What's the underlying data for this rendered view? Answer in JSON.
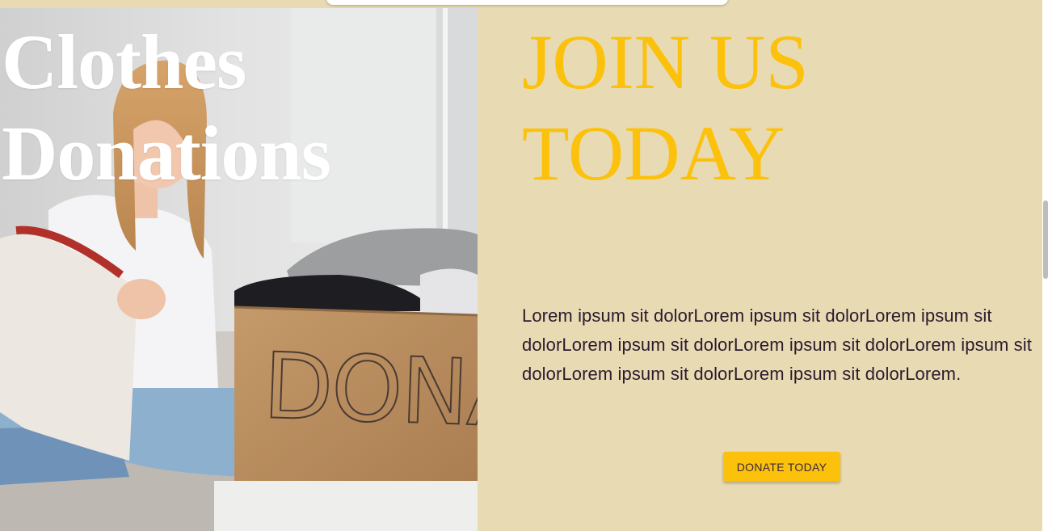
{
  "hero": {
    "title_line1": "Clothes",
    "title_line2": "Donations",
    "image": "woman-packing-clothes-donation-box-photo",
    "box_text": "DONATE"
  },
  "join": {
    "title_line1": "JOIN US",
    "title_line2": "TODAY",
    "body": "Lorem ipsum sit dolorLorem ipsum sit dolorLorem ipsum sit dolorLorem ipsum sit dolorLorem ipsum sit dolorLorem ipsum sit dolorLorem ipsum sit dolorLorem ipsum sit dolorLorem.",
    "button_label": "DONATE TODAY"
  },
  "colors": {
    "background": "#e8dab3",
    "accent": "#fcc10a",
    "body_text": "#2a1b2e",
    "hero_text": "#ffffff"
  }
}
